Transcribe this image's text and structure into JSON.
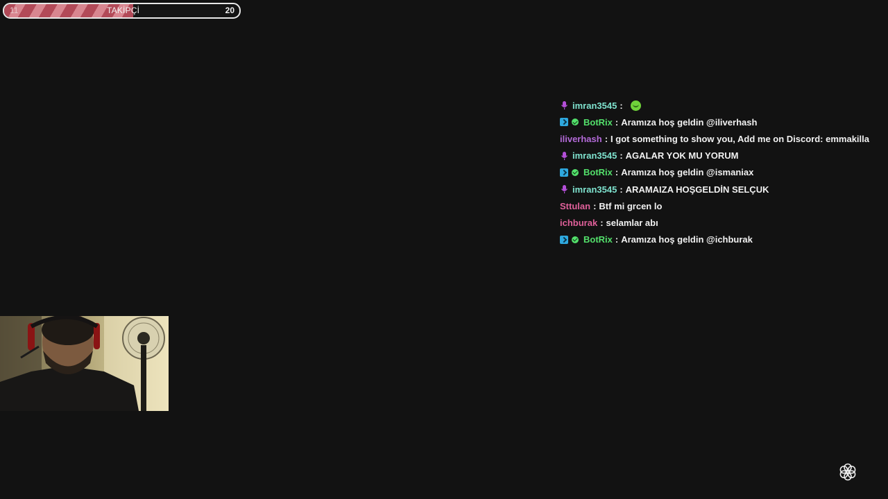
{
  "goal": {
    "label": "TAKİPÇİ",
    "min": "11",
    "max": "20",
    "progress": 0.55
  },
  "colors": {
    "background": "#121212",
    "goal_fill_dark": "#b24a58",
    "goal_fill_light": "#d88690",
    "user_cyan": "#7fe3cf",
    "user_green": "#53e06b",
    "user_purple": "#b36ad8",
    "user_pink": "#e0609a",
    "mic_badge": "#b44fd8",
    "bot_badge": "#2ea8de"
  },
  "chat": {
    "messages": [
      {
        "user": "imran3545",
        "color": "#7fe3cf",
        "badges": [
          "mic-icon"
        ],
        "text": "",
        "emote": "smile-emote"
      },
      {
        "user": "BotRix",
        "color": "#53e06b",
        "badges": [
          "bot-icon",
          "verified-icon"
        ],
        "text": "Aramıza hoş geldin @iliverhash"
      },
      {
        "user": "iliverhash",
        "color": "#b36ad8",
        "badges": [],
        "text": "I got something to show you, Add me on Discord: emmakilla"
      },
      {
        "user": "imran3545",
        "color": "#7fe3cf",
        "badges": [
          "mic-icon"
        ],
        "text": "AGALAR YOK MU YORUM"
      },
      {
        "user": "BotRix",
        "color": "#53e06b",
        "badges": [
          "bot-icon",
          "verified-icon"
        ],
        "text": "Aramıza hoş geldin @ismaniax"
      },
      {
        "user": "imran3545",
        "color": "#7fe3cf",
        "badges": [
          "mic-icon"
        ],
        "text": "ARAMAIZA HOŞGELDİN SELÇUK"
      },
      {
        "user": "Sttulan",
        "color": "#e0609a",
        "badges": [],
        "text": "Btf mi grcen lo"
      },
      {
        "user": "ichburak",
        "color": "#e0609a",
        "badges": [],
        "text": "selamlar abı"
      },
      {
        "user": "BotRix",
        "color": "#53e06b",
        "badges": [
          "bot-icon",
          "verified-icon"
        ],
        "text": "Aramıza hoş geldin @ichburak"
      }
    ]
  },
  "webcam": {
    "icon": "webcam-feed"
  },
  "logo": {
    "icon": "flower-logo-icon"
  }
}
